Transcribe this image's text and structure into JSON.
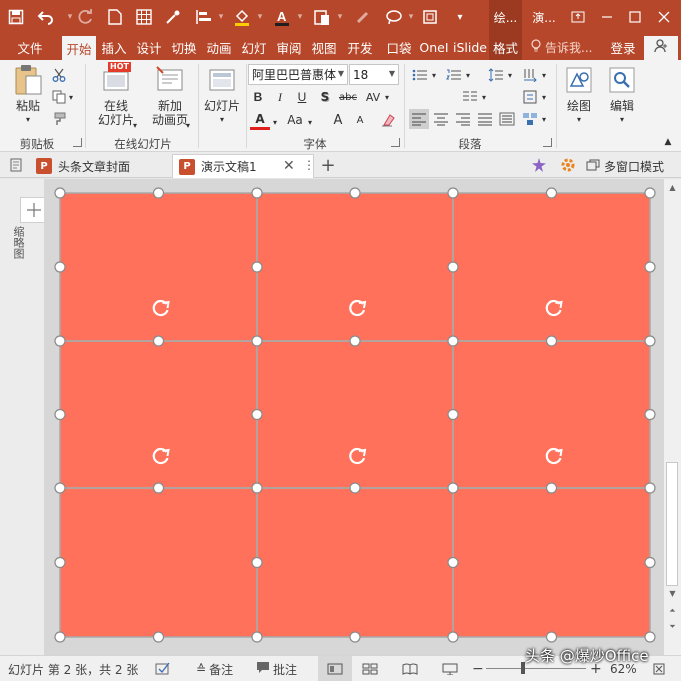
{
  "title_bar": {
    "context_tab_drawing": "绘...",
    "doc_title": "演...",
    "icons": [
      "save-icon",
      "undo-icon",
      "redo-icon",
      "new-file-icon",
      "grid-icon",
      "eyedropper-icon",
      "align-icon",
      "fill-color-icon",
      "font-color-icon",
      "paste-icon",
      "brush-icon",
      "lasso-icon",
      "crop-icon"
    ]
  },
  "tabs": [
    {
      "label": "文件"
    },
    {
      "label": "开始"
    },
    {
      "label": "插入"
    },
    {
      "label": "设计"
    },
    {
      "label": "切换"
    },
    {
      "label": "动画"
    },
    {
      "label": "幻灯"
    },
    {
      "label": "审阅"
    },
    {
      "label": "视图"
    },
    {
      "label": "开发"
    },
    {
      "label": "口袋"
    },
    {
      "label": "OneI"
    },
    {
      "label": "iSlide"
    },
    {
      "label": "格式"
    }
  ],
  "tell_me": "告诉我...",
  "login": "登录",
  "ribbon": {
    "clipboard": {
      "paste": "粘贴",
      "group": "剪贴板"
    },
    "online_slides": {
      "online_label_1": "在线",
      "online_label_2": "幻灯片",
      "hot_badge": "HOT",
      "new_label_1": "新加",
      "new_label_2": "动画页",
      "group": "在线幻灯片"
    },
    "slides": {
      "slide_label": "幻灯片"
    },
    "font": {
      "font_name": "阿里巴巴普惠体",
      "font_size": "18",
      "bold": "B",
      "italic": "I",
      "underline": "U",
      "shadow": "S",
      "strike": "abc",
      "spacing": "AV",
      "font_color": "A",
      "case": "Aa",
      "grow": "A",
      "shrink": "A",
      "group": "字体"
    },
    "paragraph": {
      "group": "段落"
    },
    "drawing": {
      "label": "绘图"
    },
    "editing": {
      "label": "编辑"
    }
  },
  "doc_tabs": [
    {
      "label": "头条文章封面"
    },
    {
      "label": "演示文稿1"
    }
  ],
  "multi_window": "多窗口模式",
  "left_pane_text": "缩略图",
  "status": {
    "slide_info": "幻灯片 第 2 张，共 2 张",
    "notes": "备注",
    "comments": "批注",
    "zoom": "62%"
  },
  "watermark": "头条 @爆炒Office",
  "colors": {
    "accent": "#b7472a",
    "slide_fill": "#ff715b"
  }
}
